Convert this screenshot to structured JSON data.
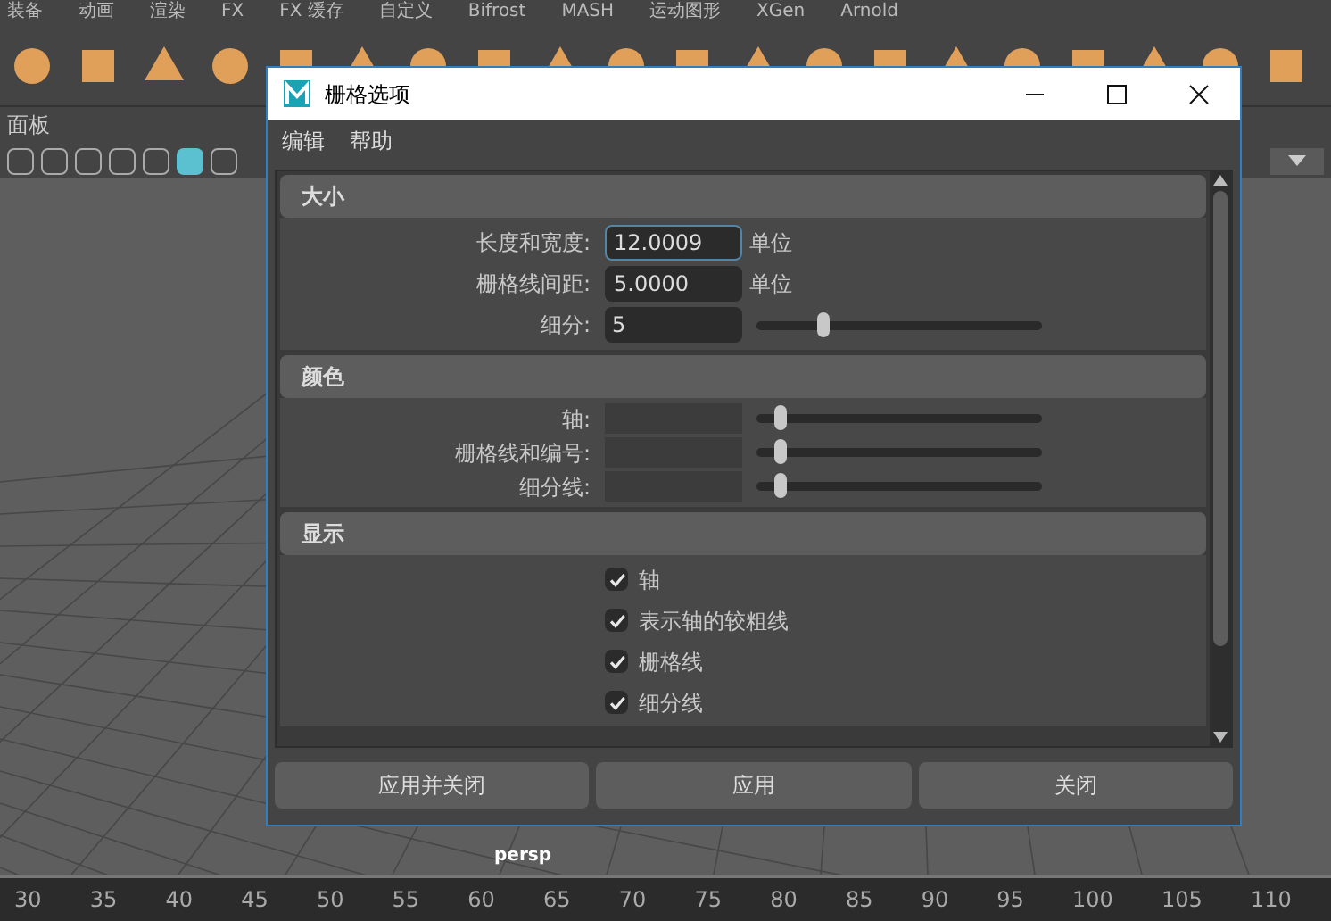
{
  "shelf_tabs": [
    "装备",
    "动画",
    "渲染",
    "FX",
    "FX 缓存",
    "自定义",
    "Bifrost",
    "MASH",
    "运动图形",
    "XGen",
    "Arnold"
  ],
  "panel_menu": "面板",
  "viewport": {
    "camera": "persp"
  },
  "timeline": {
    "ticks": [
      "30",
      "35",
      "40",
      "45",
      "50",
      "55",
      "60",
      "65",
      "70",
      "75",
      "80",
      "85",
      "90",
      "95",
      "100",
      "105",
      "110"
    ]
  },
  "dialog": {
    "title": "栅格选项",
    "menu": [
      "编辑",
      "帮助"
    ],
    "sections": [
      {
        "title": "大小",
        "rows": [
          {
            "kind": "field",
            "label": "长度和宽度:",
            "value": "12.0009",
            "unit": "单位",
            "focused": true
          },
          {
            "kind": "field",
            "label": "栅格线间距:",
            "value": "5.0000",
            "unit": "单位",
            "focused": false
          },
          {
            "kind": "field_slider",
            "label": "细分:",
            "value": "5",
            "level": 0.23
          }
        ]
      },
      {
        "title": "颜色",
        "rows": [
          {
            "kind": "color_slider",
            "label": "轴:",
            "level": 0.08
          },
          {
            "kind": "color_slider",
            "label": "栅格线和编号:",
            "level": 0.08
          },
          {
            "kind": "color_slider",
            "label": "细分线:",
            "level": 0.08
          }
        ]
      },
      {
        "title": "显示",
        "rows": [
          {
            "kind": "checkbox",
            "label": "轴",
            "checked": true
          },
          {
            "kind": "checkbox",
            "label": "表示轴的较粗线",
            "checked": true
          },
          {
            "kind": "checkbox",
            "label": "栅格线",
            "checked": true
          },
          {
            "kind": "checkbox",
            "label": "细分线",
            "checked": true
          }
        ]
      }
    ],
    "buttons": [
      "应用并关闭",
      "应用",
      "关闭"
    ]
  }
}
